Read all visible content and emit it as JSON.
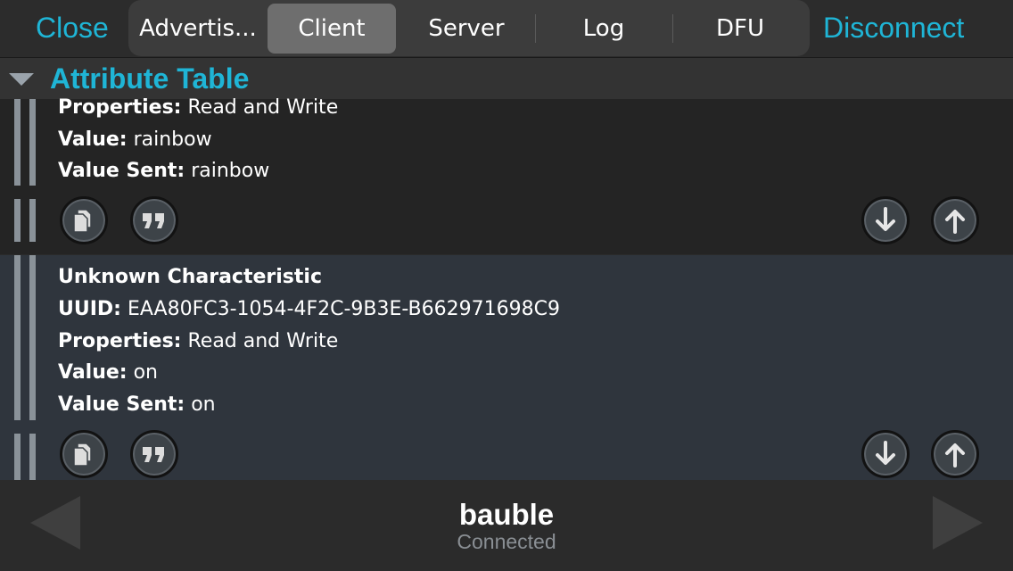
{
  "colors": {
    "accent": "#1fb5d6",
    "selected_segment": "#6e6e6e",
    "muted": "#8a8f94"
  },
  "header": {
    "close_label": "Close",
    "disconnect_label": "Disconnect",
    "tabs": [
      {
        "label": "Advertis..."
      },
      {
        "label": "Client",
        "selected": true
      },
      {
        "label": "Server"
      },
      {
        "label": "Log"
      },
      {
        "label": "DFU"
      }
    ]
  },
  "attribute_table": {
    "title": "Attribute Table",
    "characteristics": [
      {
        "properties_label": "Properties:",
        "properties": "Read and Write",
        "value_label": "Value:",
        "value": "rainbow",
        "value_sent_label": "Value Sent:",
        "value_sent": "rainbow"
      },
      {
        "name": "Unknown Characteristic",
        "uuid_label": "UUID:",
        "uuid": "EAA80FC3-1054-4F2C-9B3E-B662971698C9",
        "properties_label": "Properties:",
        "properties": "Read and Write",
        "value_label": "Value:",
        "value": "on",
        "value_sent_label": "Value Sent:",
        "value_sent": "on"
      }
    ],
    "action_icons": [
      "copy-icon",
      "quote-icon",
      "read-down-arrow-icon",
      "write-up-arrow-icon"
    ]
  },
  "device": {
    "name": "bauble",
    "status": "Connected"
  }
}
